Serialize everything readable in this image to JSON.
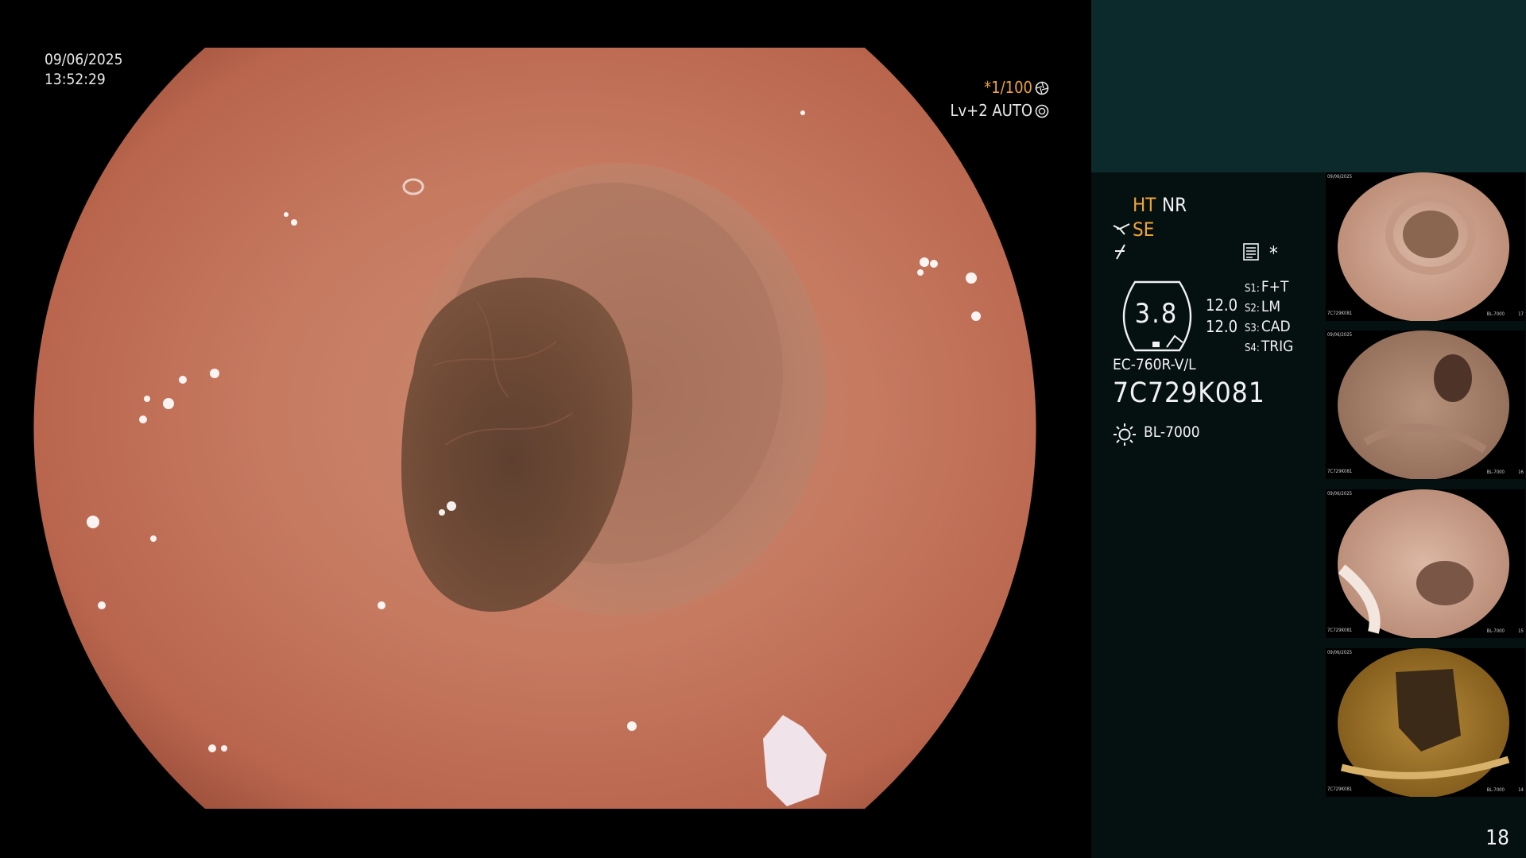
{
  "overlay": {
    "date": "09/06/2025",
    "time": "13:52:29",
    "shutter_prefix": "*",
    "shutter": "1/100",
    "iris": "Lv+2 AUTO"
  },
  "panel": {
    "ht": "HT",
    "nr": "NR",
    "se": "SE",
    "asterisk": "*",
    "gauge_value": "3.8",
    "setting_a": "12.0",
    "setting_b": "12.0",
    "switches": [
      {
        "key": "S1",
        "value": "F+T"
      },
      {
        "key": "S2",
        "value": "LM"
      },
      {
        "key": "S3",
        "value": "CAD"
      },
      {
        "key": "S4",
        "value": "TRIG"
      }
    ],
    "scope_model": "EC-760R-V/L",
    "serial": "7C729K081",
    "light_source": "BL-7000",
    "page_number": "18"
  },
  "thumbnails": [
    {
      "date": "09/06/2025",
      "serial": "7C729K081",
      "source": "BL-7000",
      "index": "17"
    },
    {
      "date": "09/06/2025",
      "serial": "7C729K081",
      "source": "BL-7000",
      "index": "16"
    },
    {
      "date": "09/06/2025",
      "serial": "7C729K081",
      "source": "BL-7000",
      "index": "15"
    },
    {
      "date": "09/06/2025",
      "serial": "7C729K081",
      "source": "BL-7000",
      "index": "14"
    }
  ],
  "colors": {
    "orange": "#f0a43a",
    "panel_bg": "#051010",
    "panel_top": "#0c2a2b",
    "tissue": "#c77a62",
    "lumen": "#6e4a36"
  },
  "icons": [
    "scissor-icon",
    "strike-icon",
    "checklist-icon",
    "sun-icon",
    "shutter-icon",
    "iris-icon"
  ]
}
